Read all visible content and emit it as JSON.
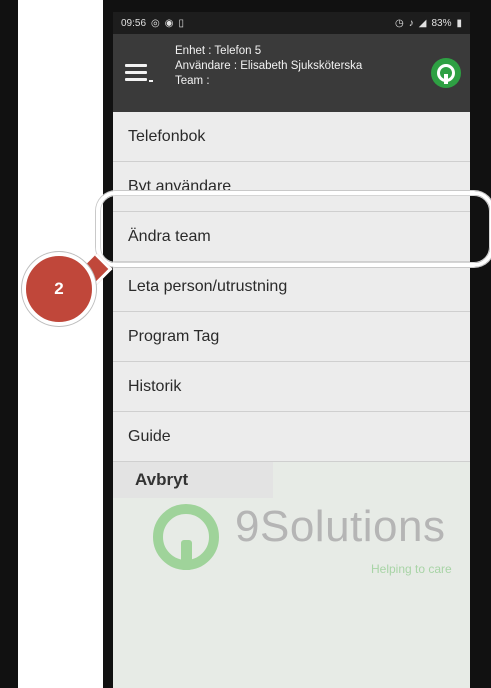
{
  "status_bar": {
    "time": "09:56",
    "battery": "83%"
  },
  "header": {
    "device_line": "Enhet : Telefon 5",
    "user_line": "Användare : Elisabeth Sjuksköterska",
    "team_line": "Team :"
  },
  "menu": {
    "items": [
      {
        "label": "Telefonbok"
      },
      {
        "label": "Byt användare"
      },
      {
        "label": "Ändra team"
      },
      {
        "label": "Leta person/utrustning"
      },
      {
        "label": "Program Tag"
      },
      {
        "label": "Historik"
      },
      {
        "label": "Guide"
      }
    ],
    "cancel_label": "Avbryt"
  },
  "brand": {
    "name": "9Solutions",
    "tagline": "Helping to care",
    "color": "#9fd39a"
  },
  "callout": {
    "step_number": "2",
    "color": "#c0473a"
  }
}
